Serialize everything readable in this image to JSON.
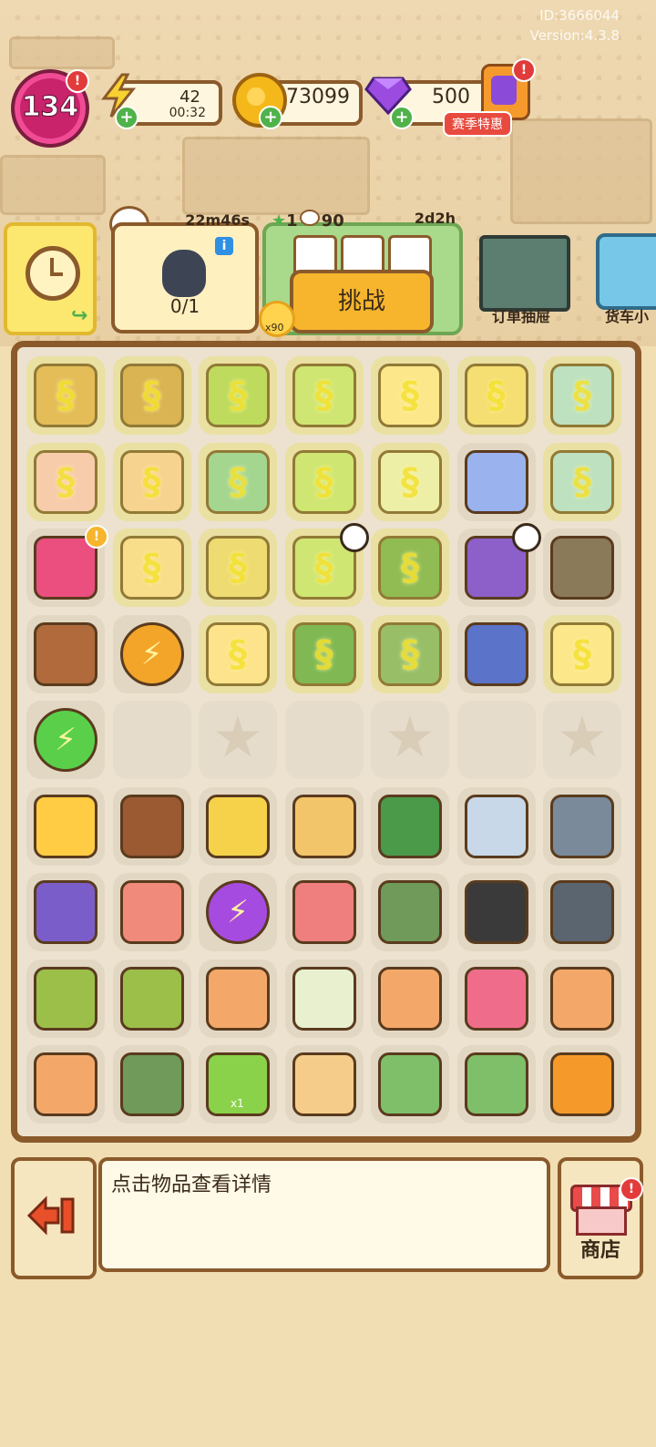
{
  "meta": {
    "player_id": "ID:3666044",
    "version": "Version:4.3.8"
  },
  "top_bar": {
    "level": "134",
    "energy": {
      "value": "42",
      "timer": "00:32"
    },
    "coins": "173099",
    "gems": "500",
    "promo_label": "赛季特惠"
  },
  "events": {
    "bag_timer": "22m46s",
    "bag_count": "0/1",
    "challenge_stars": "1",
    "challenge_points": "90",
    "challenge_time": "2d2h",
    "challenge_button": "挑战",
    "token_count": "x90",
    "order_drawer": "订单抽屉",
    "truck": "货车小"
  },
  "board": {
    "rows": [
      [
        "basket-flowers",
        "basket",
        "potted-plant",
        "laptop",
        "cup-noodles",
        "handcart",
        "rice-cooker"
      ],
      [
        "fridge",
        "fridge-open",
        "cart",
        "laptop",
        "booklet",
        "pillow",
        "rice-cooker"
      ],
      [
        "backpack",
        "boxes",
        "pallet-boxes",
        "laptop",
        "toolbox",
        "clutter-chest",
        "locker"
      ],
      [
        "trash-bags",
        "energy-orb-orange",
        "bread-bun",
        "green-case",
        "green-chest",
        "neck-pillow",
        "cup-noodles"
      ],
      [
        "energy-orb-green",
        "empty",
        "star-slot",
        "empty",
        "star-slot",
        "empty",
        "star-slot"
      ],
      [
        "flower-bouquet",
        "wallet",
        "banana-peel",
        "fox-plush",
        "pliers",
        "dumbbells",
        "wrench"
      ],
      [
        "lavender-pot",
        "tulip-crate",
        "energy-orb-purple",
        "watering-can",
        "gloves",
        "crowbar",
        "treadmill"
      ],
      [
        "seed-bag",
        "seed-bag",
        "salad-bowl",
        "bandage-box",
        "salad-bowl",
        "hose",
        "salad-bowl"
      ],
      [
        "salad-bowl",
        "gloves",
        "energy-button",
        "sandwich",
        "glove-green",
        "glove-green",
        "book"
      ]
    ],
    "locked_cells": [
      "0-0",
      "0-1",
      "0-2",
      "0-3",
      "0-4",
      "0-5",
      "0-6",
      "1-0",
      "1-1",
      "1-2",
      "1-3",
      "1-4",
      "1-6",
      "2-1",
      "2-2",
      "2-3",
      "2-4",
      "3-2",
      "3-3",
      "3-4",
      "3-6"
    ],
    "energy_button_count": "x1"
  },
  "bottom": {
    "info_text": "点击物品查看详情",
    "shop_label": "商店"
  },
  "colors": {
    "frame": "#8b5a2b",
    "background": "#f0dfb2",
    "accent_yellow": "#f6b52d",
    "badge_red": "#e23b3b"
  }
}
